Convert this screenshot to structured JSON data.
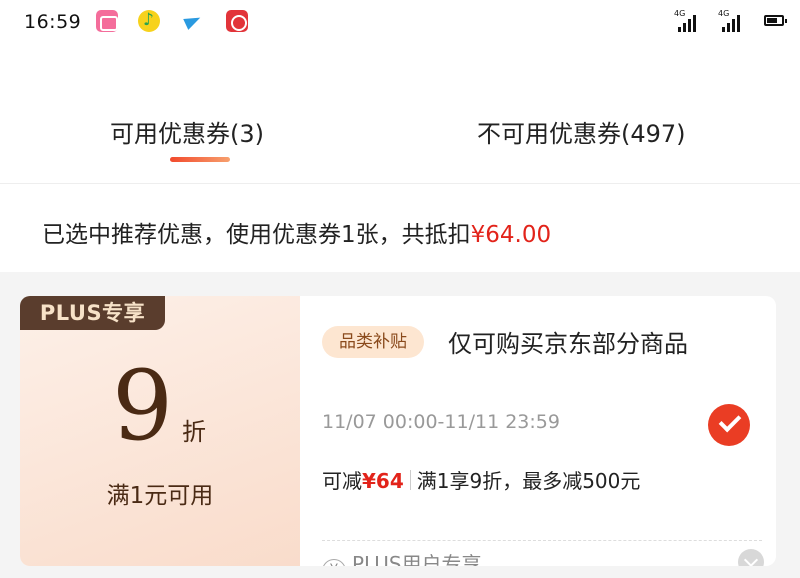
{
  "status_bar": {
    "time": "16:59",
    "apps": [
      "bilibili-icon",
      "music-icon",
      "plane-icon",
      "netease-music-icon"
    ],
    "signal_label": "4G"
  },
  "tabs": {
    "available": "可用优惠券(3)",
    "unavailable": "不可用优惠券(497)",
    "active": "available",
    "accent_color": "#f24a2c"
  },
  "summary": {
    "text": "已选中推荐优惠，使用优惠券1张，共抵扣",
    "amount": "¥64.00"
  },
  "coupon": {
    "badge": "PLUS专享",
    "discount_value": "9",
    "discount_unit": "折",
    "min_spend": "满1元可用",
    "tag": "品类补贴",
    "scope": "仅可购买京东部分商品",
    "validity": "11/07 00:00-11/11 23:59",
    "selected": true,
    "deduct_prefix": "可减",
    "deduct_amount": "¥64",
    "rule": "满1享9折，最多减500元",
    "footer_icon": "¥",
    "footer_text": "PLUS用户专享"
  },
  "colors": {
    "price_red": "#e2231a",
    "check_red": "#ea3d24",
    "badge_brown": "#5a3d2d",
    "tag_bg": "#fde6d1"
  }
}
